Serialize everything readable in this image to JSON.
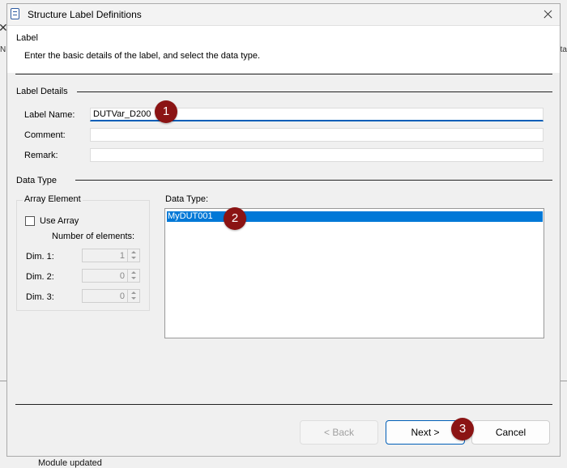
{
  "background": {
    "close_glyph": "✕",
    "left_letter": "N",
    "right_text": "ta",
    "status_text": "Module updated"
  },
  "dialog": {
    "title": "Structure Label Definitions",
    "header_title": "Label",
    "header_desc": "Enter the basic details of the label, and select the data type.",
    "label_details": {
      "section_title": "Label Details",
      "label_name_caption": "Label Name:",
      "label_name_value": "DUTVar_D200",
      "comment_caption": "Comment:",
      "comment_value": "",
      "remark_caption": "Remark:",
      "remark_value": ""
    },
    "data_type": {
      "section_title": "Data Type",
      "array_group_title": "Array Element",
      "use_array_label": "Use Array",
      "use_array_checked": false,
      "num_elements_label": "Number of elements:",
      "dims": [
        {
          "label": "Dim. 1:",
          "value": "1"
        },
        {
          "label": "Dim. 2:",
          "value": "0"
        },
        {
          "label": "Dim. 3:",
          "value": "0"
        }
      ],
      "list_caption": "Data Type:",
      "list_items": [
        "MyDUT001"
      ],
      "selected_item": "MyDUT001"
    },
    "buttons": {
      "back": "< Back",
      "next": "Next >",
      "cancel": "Cancel"
    },
    "annotations": [
      "1",
      "2",
      "3"
    ],
    "colors": {
      "accent": "#0078d7",
      "badge": "#8b1414"
    }
  }
}
